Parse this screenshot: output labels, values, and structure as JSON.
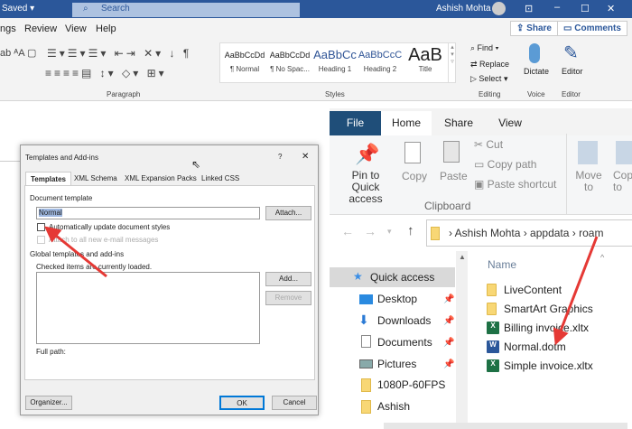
{
  "word": {
    "title_status": "Saved ▾",
    "search_placeholder": "Search",
    "user": "Ashish Mohta",
    "menu": [
      "ngs",
      "Review",
      "View",
      "Help"
    ],
    "share": "Share",
    "comments": "Comments",
    "styles": [
      {
        "preview": "AaBbCcDd",
        "name": "¶ Normal"
      },
      {
        "preview": "AaBbCcDd",
        "name": "¶ No Spac..."
      },
      {
        "preview": "AaBbCc",
        "name": "Heading 1"
      },
      {
        "preview": "AaBbCcC",
        "name": "Heading 2"
      },
      {
        "preview": "AaB",
        "name": "Title"
      }
    ],
    "editing": {
      "find": "Find",
      "replace": "Replace",
      "select": "Select"
    },
    "dictate": "Dictate",
    "editor": "Editor",
    "groups": {
      "paragraph": "Paragraph",
      "styles": "Styles",
      "editing": "Editing",
      "voice": "Voice",
      "editor": "Editor"
    }
  },
  "dialog": {
    "title": "Templates and Add-ins",
    "help": "?",
    "close": "✕",
    "tabs": [
      "Templates",
      "XML Schema",
      "XML Expansion Packs",
      "Linked CSS"
    ],
    "document_template_label": "Document template",
    "template_value": "Normal",
    "attach": "Attach...",
    "auto_update": "Automatically update document styles",
    "attach_email": "Attach to all new e-mail messages",
    "global_label": "Global templates and add-ins",
    "checked_note": "Checked items are currently loaded.",
    "add": "Add...",
    "remove": "Remove",
    "full_path": "Full path:",
    "organizer": "Organizer...",
    "ok": "OK",
    "cancel": "Cancel"
  },
  "explorer": {
    "tabs": [
      "File",
      "Home",
      "Share",
      "View"
    ],
    "ribbon": {
      "pin": "Pin to Quick access",
      "copy": "Copy",
      "paste": "Paste",
      "cut": "Cut",
      "copy_path": "Copy path",
      "paste_shortcut": "Paste shortcut",
      "clipboard": "Clipboard",
      "move_to": "Move to",
      "copy_to": "Copy to"
    },
    "path": [
      "Ashish Mohta",
      "appdata",
      "roam"
    ],
    "nav": [
      "Quick access",
      "Desktop",
      "Downloads",
      "Documents",
      "Pictures",
      "1080P-60FPS",
      "Ashish"
    ],
    "name_header": "Name",
    "files": [
      {
        "name": "LiveContent",
        "type": "folder"
      },
      {
        "name": "SmartArt Graphics",
        "type": "folder"
      },
      {
        "name": "Billing invoice.xltx",
        "type": "excel"
      },
      {
        "name": "Normal.dotm",
        "type": "word"
      },
      {
        "name": "Simple invoice.xltx",
        "type": "excel"
      }
    ]
  },
  "colors": {
    "word_blue": "#2b579a",
    "file_tab": "#1f4e79",
    "arrow": "#e53935"
  }
}
